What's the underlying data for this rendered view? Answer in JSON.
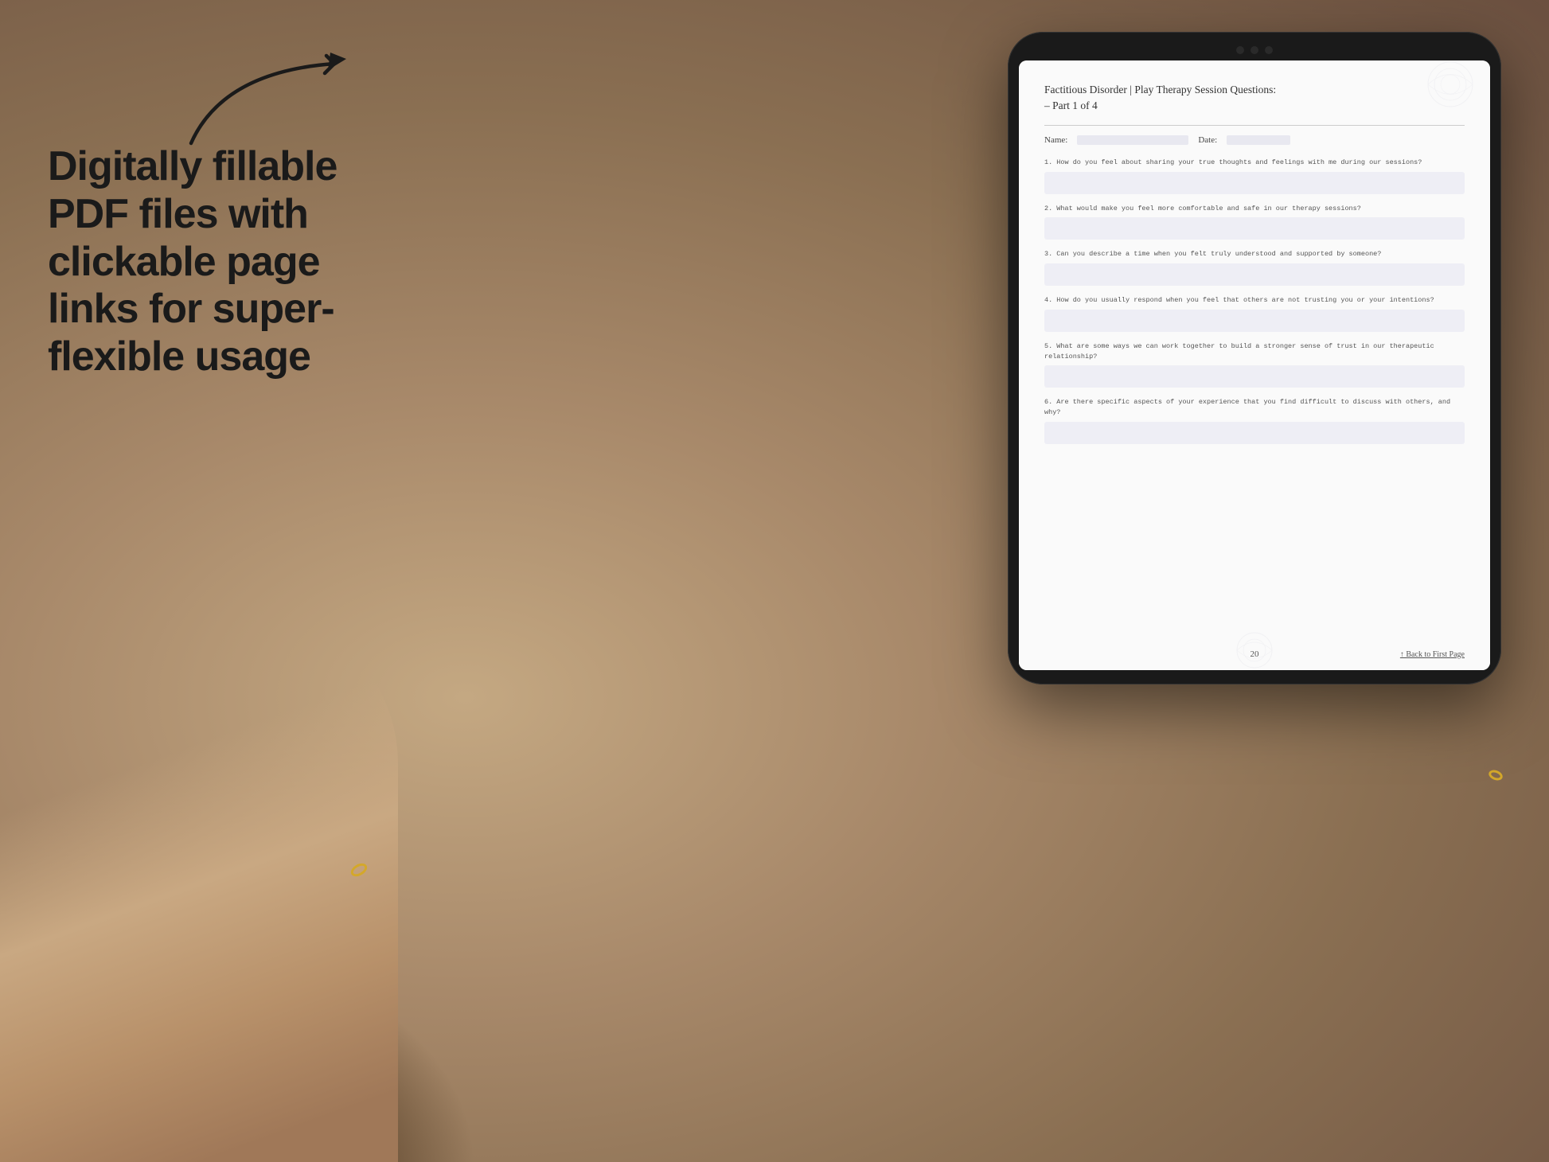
{
  "background": {
    "color": "#b8a090"
  },
  "left_text": {
    "tagline": "Digitally fillable PDF files with clickable page links for super-flexible usage"
  },
  "arrow": {
    "description": "curved arrow pointing right toward tablet"
  },
  "tablet": {
    "camera_dots": 3
  },
  "pdf": {
    "title": "Factitious Disorder | Play Therapy Session Questions:",
    "subtitle": "– Part 1 of 4",
    "name_label": "Name:",
    "date_label": "Date:",
    "questions": [
      {
        "number": "1.",
        "text": "How do you feel about sharing your true thoughts and feelings with me during our sessions?"
      },
      {
        "number": "2.",
        "text": "What would make you feel more comfortable and safe in our therapy sessions?"
      },
      {
        "number": "3.",
        "text": "Can you describe a time when you felt truly understood and supported by someone?"
      },
      {
        "number": "4.",
        "text": "How do you usually respond when you feel that others are not trusting you or your intentions?"
      },
      {
        "number": "5.",
        "text": "What are some ways we can work together to build a stronger sense of trust in our therapeutic relationship?"
      },
      {
        "number": "6.",
        "text": "Are there specific aspects of your experience that you find difficult to discuss with others, and why?"
      }
    ],
    "footer": {
      "page_number": "20",
      "back_link": "↑ Back to First Page"
    }
  }
}
